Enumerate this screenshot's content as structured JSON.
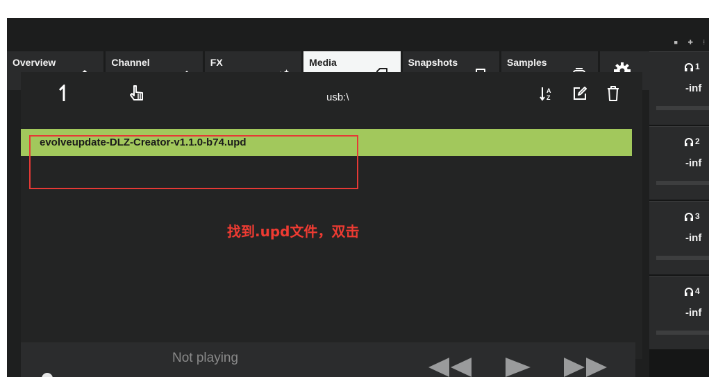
{
  "tabs": [
    {
      "label": "Overview",
      "icon": "home-icon"
    },
    {
      "label": "Channel",
      "icon": "pencil-icon"
    },
    {
      "label": "FX",
      "icon": "sparkle-icon"
    },
    {
      "label": "Media",
      "icon": "sd-card-icon"
    },
    {
      "label": "Snapshots",
      "icon": "bookmark-icon"
    },
    {
      "label": "Samples",
      "icon": "sample-pad-icon"
    }
  ],
  "active_tab": "Media",
  "toolbar": {
    "path": "usb:\\"
  },
  "files": [
    {
      "name": "evolveupdate-DLZ-Creator-v1.1.0-b74.upd",
      "selected": true
    }
  ],
  "annotation": "找到.upd文件，双击",
  "player": {
    "status": "Not playing"
  },
  "mixer": [
    {
      "num": "1",
      "level": "-inf"
    },
    {
      "num": "2",
      "level": "-inf"
    },
    {
      "num": "3",
      "level": "-inf"
    },
    {
      "num": "4",
      "level": "-inf"
    }
  ],
  "colors": {
    "selection": "#a2c85c",
    "annotation": "#ee3b32",
    "active_tab": "#f4f6f6"
  }
}
